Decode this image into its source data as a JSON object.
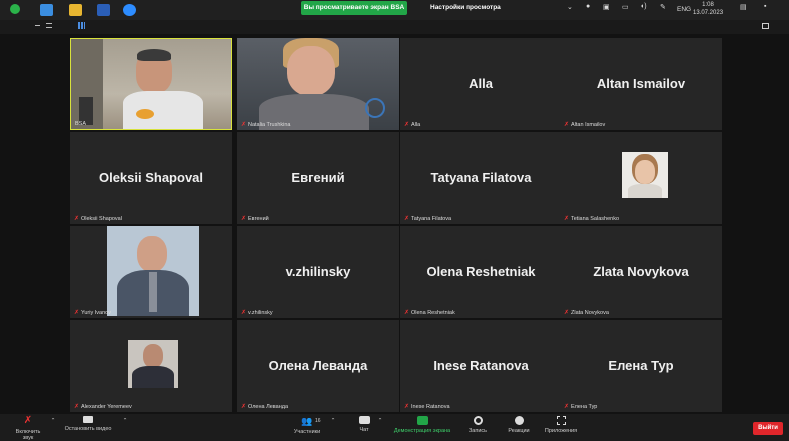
{
  "taskbar": {
    "share_banner": "Вы просматриваете экран BSA",
    "view_options": "Настройки просмотра ⌄",
    "lang": "ENG",
    "time": "1:08",
    "date": "13.07.2023"
  },
  "tiles": [
    {
      "name": "",
      "label": "BSA",
      "muted": false
    },
    {
      "name": "",
      "label": "Natalia Trushkina",
      "muted": true
    },
    {
      "name": "Alla",
      "label": "Alla",
      "muted": true
    },
    {
      "name": "Altan Ismailov",
      "label": "Altan Ismailov",
      "muted": true
    },
    {
      "name": "Oleksii Shapoval",
      "label": "Oleksii Shapoval",
      "muted": true
    },
    {
      "name": "Евгений",
      "label": "Евгений",
      "muted": true
    },
    {
      "name": "Tatyana Filatova",
      "label": "Tatyana Filatova",
      "muted": true
    },
    {
      "name": "",
      "label": "Tetiana Salashenko",
      "muted": true
    },
    {
      "name": "",
      "label": "Yuriy Ivanov",
      "muted": true
    },
    {
      "name": "v.zhilinsky",
      "label": "v.zhilinsky",
      "muted": true
    },
    {
      "name": "Olena Reshetniak",
      "label": "Olena Reshetniak",
      "muted": true
    },
    {
      "name": "Zlata Novykova",
      "label": "Zlata Novykova",
      "muted": true
    },
    {
      "name": "",
      "label": "Alexander Yeremeev",
      "muted": true
    },
    {
      "name": "Олена Леванда",
      "label": "Олена Леванда",
      "muted": true
    },
    {
      "name": "Inese Ratanova",
      "label": "Inese Ratanova",
      "muted": true
    },
    {
      "name": "Елена Тур",
      "label": "Елена Тур",
      "muted": true
    }
  ],
  "toolbar": {
    "unmute": "Включить звук",
    "start_video": "Остановить видео",
    "participants": "Участники",
    "participants_count": "16",
    "chat": "Чат",
    "share_screen": "Демонстрация экрана",
    "record": "Запись",
    "reactions": "Реакции",
    "apps": "Приложения",
    "end": "Выйти"
  },
  "colors": {
    "active_border": "#d8e23c",
    "share_green": "#22a648",
    "end_red": "#e0262b",
    "muted_red": "#e33333"
  }
}
